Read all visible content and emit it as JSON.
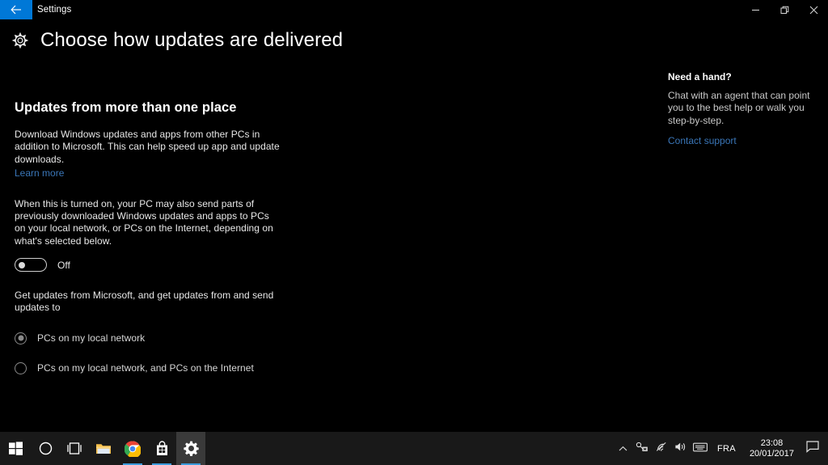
{
  "window": {
    "title": "Settings",
    "back_icon": "back-arrow-icon",
    "minimize_label": "Minimize",
    "restore_label": "Restore",
    "close_label": "Close"
  },
  "page": {
    "icon": "gear-icon",
    "title": "Choose how updates are delivered"
  },
  "main": {
    "section_title": "Updates from more than one place",
    "paragraph_1": "Download Windows updates and apps from other PCs in addition to Microsoft. This can help speed up app and update downloads.",
    "learn_more": "Learn more",
    "paragraph_2": "When this is turned on, your PC may also send parts of previously downloaded Windows updates and apps to PCs on your local network, or PCs on the Internet, depending on what's selected below.",
    "toggle": {
      "state_label": "Off",
      "checked": false
    },
    "radio_group_label": "Get updates from Microsoft, and get updates from and send updates to",
    "radios": [
      {
        "label": "PCs on my local network",
        "selected": true
      },
      {
        "label": "PCs on my local network, and PCs on the Internet",
        "selected": false
      }
    ]
  },
  "help": {
    "title": "Need a hand?",
    "body": "Chat with an agent that can point you to the best help or walk you step-by-step.",
    "link": "Contact support"
  },
  "taskbar": {
    "items": [
      {
        "name": "start-button",
        "icon": "windows-logo-icon",
        "active": false,
        "running": false
      },
      {
        "name": "cortana-search",
        "icon": "circle-icon",
        "active": false,
        "running": false
      },
      {
        "name": "task-view",
        "icon": "task-view-icon",
        "active": false,
        "running": false
      },
      {
        "name": "file-explorer",
        "icon": "folder-icon",
        "active": false,
        "running": false
      },
      {
        "name": "google-chrome",
        "icon": "chrome-icon",
        "active": false,
        "running": true
      },
      {
        "name": "microsoft-store",
        "icon": "store-bag-icon",
        "active": false,
        "running": true
      },
      {
        "name": "settings-app",
        "icon": "gear-icon",
        "active": true,
        "running": true
      }
    ],
    "tray": {
      "show_hidden_icon": "chevron-up-icon",
      "network_icon": "network-error-icon",
      "wifi_icon": "wifi-icon",
      "volume_icon": "speaker-icon",
      "keyboard_icon": "keyboard-icon",
      "language": "FRA",
      "time": "23:08",
      "date": "20/01/2017",
      "action_center_icon": "action-center-icon"
    }
  },
  "colors": {
    "accent": "#0078d7",
    "link": "#3a76b8",
    "window_background": "#000000",
    "taskbar_background": "#191919",
    "running_indicator": "#3a9bdc"
  }
}
